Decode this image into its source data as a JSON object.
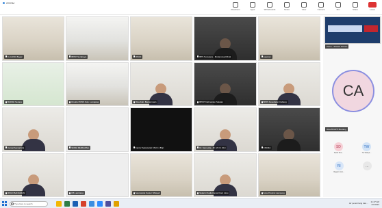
{
  "window": {
    "title": "ZOOM"
  },
  "toolbar": [
    {
      "label": "Reactions",
      "icon": "reactions-icon"
    },
    {
      "label": "Apps",
      "icon": "apps-icon"
    },
    {
      "label": "Whiteboards",
      "icon": "whiteboard-icon"
    },
    {
      "label": "Notes",
      "icon": "notes-icon"
    },
    {
      "label": "View",
      "icon": "view-icon"
    },
    {
      "label": "Camera",
      "icon": "camera-icon"
    },
    {
      "label": "Mic",
      "icon": "mic-icon"
    },
    {
      "label": "Share",
      "icon": "share-icon"
    },
    {
      "label": "Leave",
      "icon": "leave-icon"
    }
  ],
  "participants": [
    {
      "name": "K-CLINIC Bogor",
      "scene": "room"
    },
    {
      "name": "BPKP Surabaya",
      "scene": "office"
    },
    {
      "name": "RSUD",
      "scene": "room"
    },
    {
      "name": "BPS Sumatera - Muhammad Rizal",
      "scene": "dark"
    },
    {
      "name": "Laporan",
      "scene": "room"
    },
    {
      "name": "BUDSK Serang",
      "scene": "banner"
    },
    {
      "name": "Direktur BPJS Kab. Lumajang",
      "scene": "office"
    },
    {
      "name": "Rina Kab. Banjarmasin",
      "scene": "person"
    },
    {
      "name": "BPKP Kalimantan Selatan",
      "scene": "dark"
    },
    {
      "name": "BPJS Kesehatan Cabang",
      "scene": "person"
    },
    {
      "name": "Camat Samarinda",
      "scene": "person"
    },
    {
      "name": "SOBU PERKASSA",
      "scene": "blank"
    },
    {
      "name": "Kantor Sekretariat KSU 11 Bnjr",
      "scene": "black"
    },
    {
      "name": "Dr. Samudra - Dr. M. Dr. Dini",
      "scene": "person"
    },
    {
      "name": "CNCRA",
      "scene": "dark"
    },
    {
      "name": "RSUD BANJARAN",
      "scene": "person"
    },
    {
      "name": "KB Lambang",
      "scene": "blank"
    },
    {
      "name": "Sekretariat Kantor Wilayah",
      "scene": "room"
    },
    {
      "name": "Sukarni Kadis Kanwil Kab. Hulu",
      "scene": "person"
    },
    {
      "name": "Kota Provinsi Lampung",
      "scene": "room"
    }
  ],
  "side_panel": {
    "share_name": "Zoom - Shared Screen",
    "active_speaker_initials": "CA",
    "active_speaker_label": "Dika BKAPP Bontang",
    "mini_attendees": [
      {
        "initials": "SD",
        "label": "Sandi Dini...",
        "color": "#f6d0d6",
        "text_color": "#b33a55"
      },
      {
        "initials": "TW",
        "label": "Tio Widiya...",
        "color": "#d2e3f6",
        "text_color": "#2a6cc2"
      },
      {
        "initials": "RI",
        "label": "Ragam Indo...",
        "color": "#d8e6f8",
        "text_color": "#2a6cc2"
      },
      {
        "initials": "...",
        "label": "",
        "color": "#e8e8e8",
        "text_color": "#666"
      }
    ]
  },
  "taskbar": {
    "search_placeholder": "Type here to search",
    "tray_text": "Air penuh lang dan...",
    "time": "11:47 AM",
    "date": "4/7/2023"
  },
  "colors": {
    "accent": "#1f6fd0",
    "leave": "#d33333",
    "avatar_ring": "#8b8fe0"
  }
}
